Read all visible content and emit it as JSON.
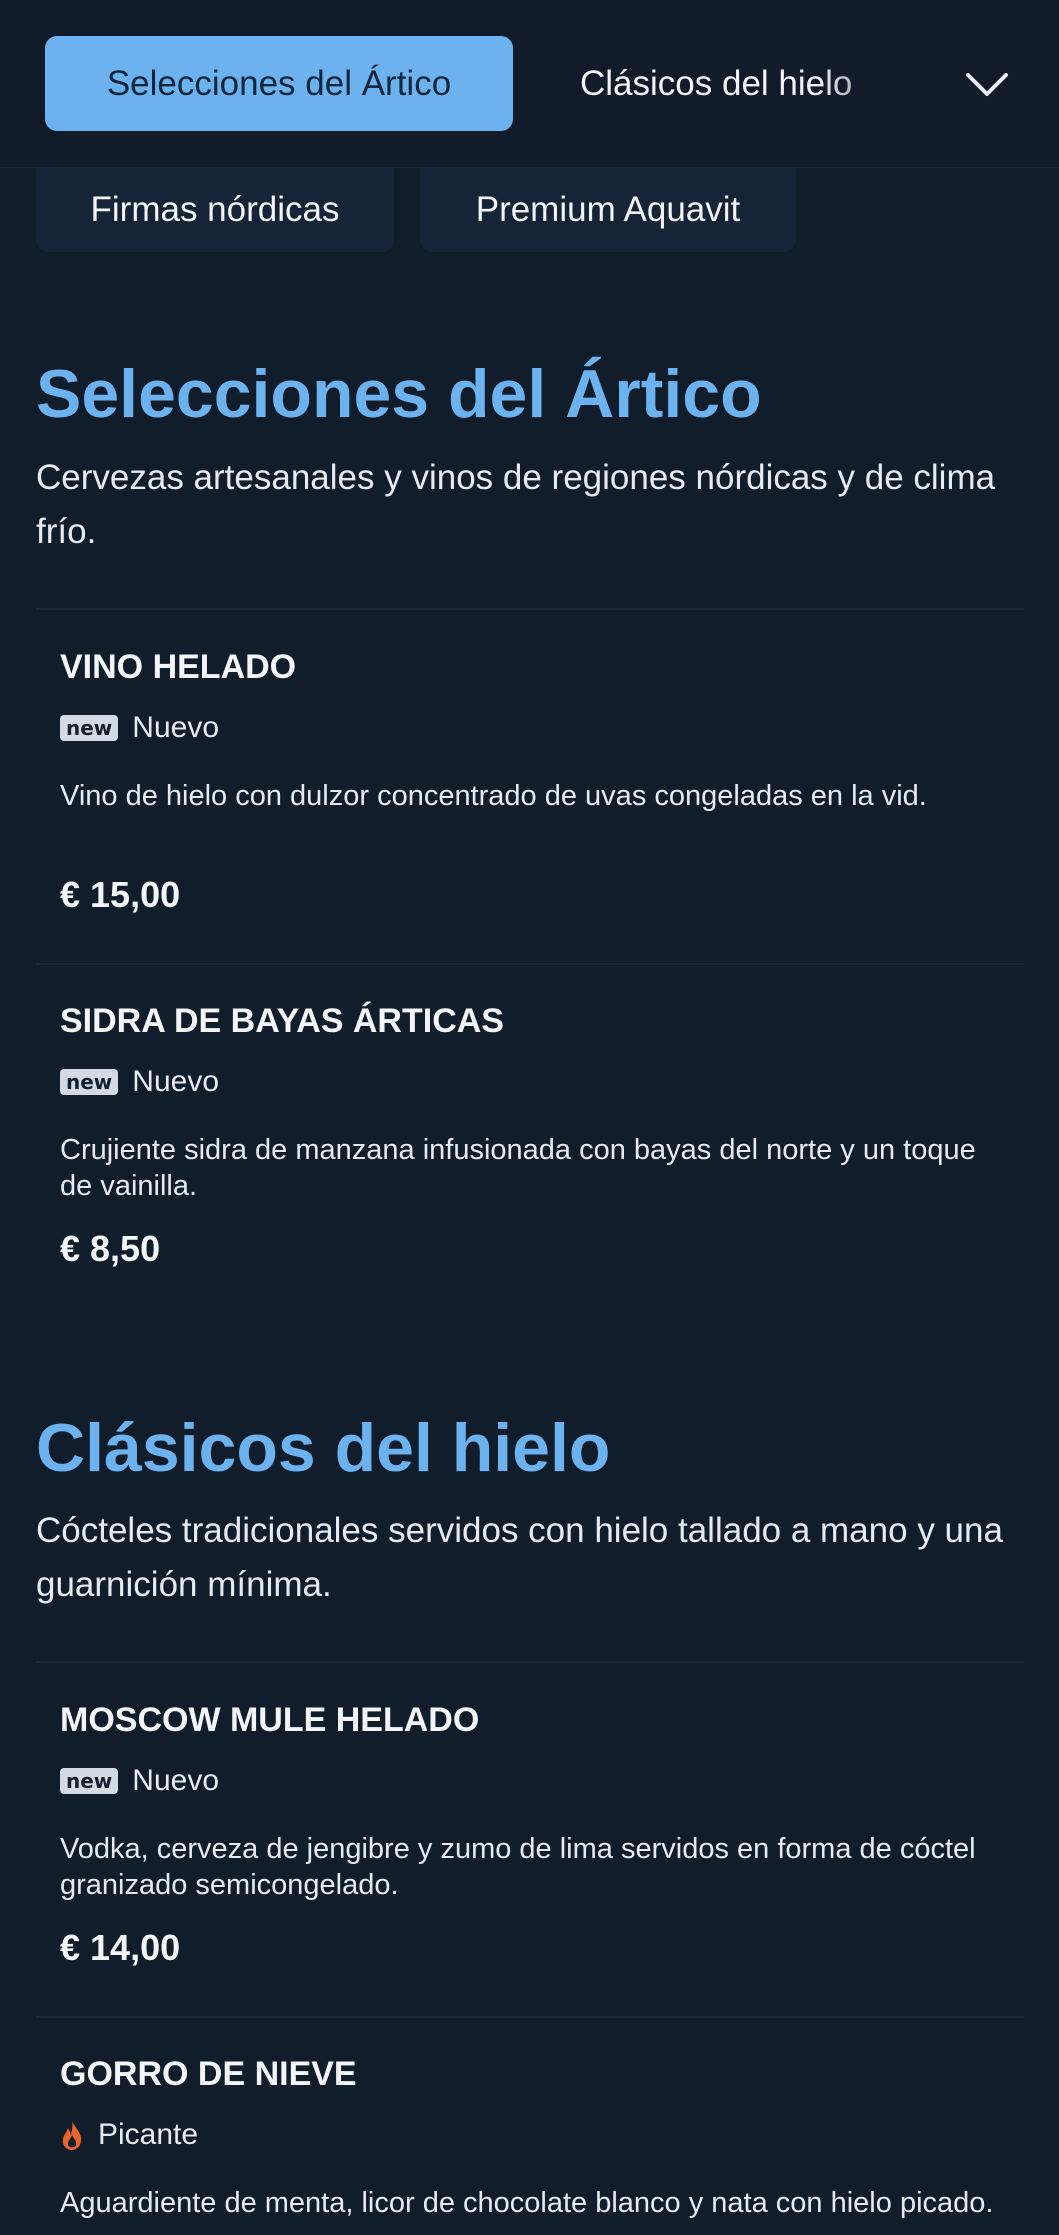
{
  "nav": {
    "active_tab": "Selecciones del Ártico",
    "next_tab": "Clásicos del hielo",
    "subtabs": [
      "Firmas nórdicas",
      "Premium Aquavit"
    ]
  },
  "sections": [
    {
      "title": "Selecciones del Ártico",
      "description": "Cervezas artesanales y vinos de regiones nórdicas y de clima frío.",
      "items": [
        {
          "name": "VINO HELADO",
          "badge": "new",
          "tag": "Nuevo",
          "description": "Vino de hielo con dulzor concentrado de uvas congeladas en la vid.",
          "price": "€ 15,00"
        },
        {
          "name": "SIDRA DE BAYAS ÁRTICAS",
          "badge": "new",
          "tag": "Nuevo",
          "description": "Crujiente sidra de manzana infusionada con bayas del norte y un toque de vainilla.",
          "price": "€ 8,50"
        }
      ]
    },
    {
      "title": "Clásicos del hielo",
      "description": "Cócteles tradicionales servidos con hielo tallado a mano y una guarnición mínima.",
      "items": [
        {
          "name": "MOSCOW MULE HELADO",
          "badge": "new",
          "tag": "Nuevo",
          "description": "Vodka, cerveza de jengibre y zumo de lima servidos en forma de cóctel granizado semicongelado.",
          "price": "€ 14,00"
        },
        {
          "name": "GORRO DE NIEVE",
          "icon": "flame-icon",
          "tag": "Picante",
          "description": "Aguardiente de menta, licor de chocolate blanco y nata con hielo picado."
        }
      ]
    }
  ],
  "colors": {
    "background": "#121d2b",
    "accent": "#6cb2ee",
    "spicy": "#e8642c"
  }
}
